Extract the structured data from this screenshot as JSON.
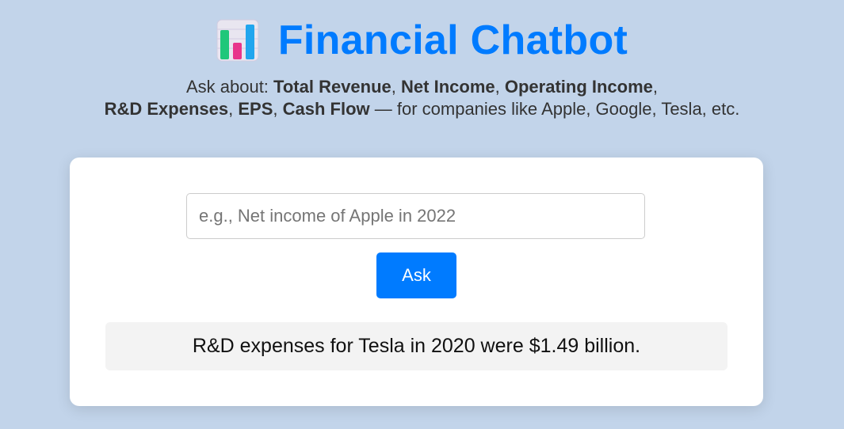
{
  "header": {
    "icon": "bar-chart-icon",
    "title": "Financial Chatbot"
  },
  "subtitle": {
    "prefix": "Ask about: ",
    "metrics": [
      "Total Revenue",
      "Net Income",
      "Operating Income",
      "R&D Expenses",
      "EPS",
      "Cash Flow"
    ],
    "separator": ", ",
    "dash_suffix": " — for companies like Apple, Google, Tesla, etc."
  },
  "form": {
    "input_value": "",
    "input_placeholder": "e.g., Net income of Apple in 2022",
    "ask_label": "Ask"
  },
  "answer": {
    "text": "R&D expenses for Tesla in 2020 were $1.49 billion."
  },
  "colors": {
    "background": "#c2d4ea",
    "accent": "#007bff",
    "card": "#ffffff",
    "answer_bg": "#f3f3f3"
  }
}
